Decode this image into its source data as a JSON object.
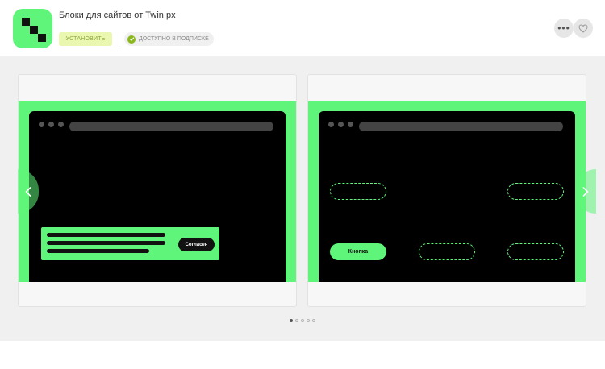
{
  "app": {
    "title": "Блоки для сайтов от Twin px",
    "install_label": "УСТАНОВИТЬ",
    "subscription_label": "ДОСТУПНО В ПОДПИСКЕ",
    "more_label": "•••"
  },
  "colors": {
    "brand_green": "#5ff57a",
    "install_bg": "#eaf7b0",
    "check_green": "#8cb81f"
  },
  "icons": {
    "more": "more-dots-icon",
    "favorite": "heart-icon",
    "check": "check-circle-icon",
    "prev": "chevron-left-icon",
    "next": "chevron-right-icon"
  },
  "slides": [
    {
      "agree_label": "Согласен"
    },
    {
      "button_label": "Кнопка"
    }
  ],
  "pagination": {
    "count": 5,
    "active": 1
  }
}
